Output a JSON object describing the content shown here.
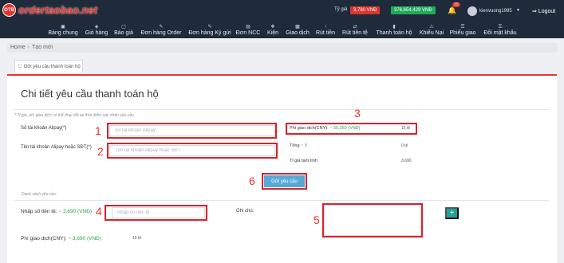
{
  "header": {
    "logo_badge": "OTB",
    "logo_text": "ordertaobao.net",
    "rate_label": "Tỷ giá",
    "rate_value": "3,780 VNĐ",
    "balance": "376,654,429 VNĐ",
    "notification_count": "10",
    "username": "kienvuong1995",
    "logout": "Logout"
  },
  "nav": {
    "items": [
      {
        "label": "Bảng chung",
        "icon": "dashboard-icon"
      },
      {
        "label": "Giỏ hàng",
        "icon": "cart-icon"
      },
      {
        "label": "Báo giá",
        "icon": "quote-icon"
      },
      {
        "label": "Đơn hàng Order",
        "icon": "order-icon"
      },
      {
        "label": "Đơn hàng Ký gửi",
        "icon": "consign-icon"
      },
      {
        "label": "Đơn NCC",
        "icon": "supplier-icon"
      },
      {
        "label": "Kiện",
        "icon": "package-icon"
      },
      {
        "label": "Giao dịch",
        "icon": "transaction-icon"
      },
      {
        "label": "Rút tiền",
        "icon": "withdraw-icon"
      },
      {
        "label": "Rút tiền tệ",
        "icon": "currency-withdraw-icon"
      },
      {
        "label": "Thanh toán hộ",
        "icon": "payment-icon"
      },
      {
        "label": "Khiếu Nại",
        "icon": "complaint-icon"
      },
      {
        "label": "Phiếu giao",
        "icon": "delivery-note-icon"
      },
      {
        "label": "Đổi mật khẩu",
        "icon": "key-icon"
      }
    ]
  },
  "breadcrumb": {
    "home": "Home",
    "current": "Tạo mới"
  },
  "tab": {
    "label": "Gửi yêu cầu thanh toán hộ"
  },
  "form": {
    "title": "Chi tiết yêu cầu thanh toán hộ",
    "note": "* Tỉ giá, phí giao dịch có thể thay đổi tại thời điểm xác nhận yêu cầu",
    "alipay_label": "Số tài khoản Alipay(*)",
    "alipay_placeholder": "Số tài khoản Alipay",
    "name_label": "Tên tài khoản Alipay hoặc SĐT(*)",
    "name_placeholder": "Tên tài khoản Alipay hoặc SĐT",
    "fee_label": "Phí giao dịch(CNY):",
    "fee_vnd": "~ 55,350 (VNĐ)",
    "fee_value": "15 tệ",
    "total_label": "Tổng",
    "total_vnd": "~ 0",
    "total_value": "0 tệ",
    "rate_label": "Tỉ giá tạm tính",
    "rate_value": "3,690",
    "submit": "Gửi yêu cầu",
    "list_title": "Danh sách yêu cầu:",
    "amount_label": "Nhập số tiền tệ:",
    "amount_vnd": "~ 3,690 (VNĐ)",
    "amount_placeholder": "Nhập số tiền tệ",
    "note_label": "Ghi chú:",
    "row_fee_label": "Phí giao dịch(CNY):",
    "row_fee_vnd": "~ 3,690 (VNĐ)",
    "row_fee_value": "15 tệ",
    "add": "+"
  },
  "annotations": [
    "1",
    "2",
    "3",
    "4",
    "5",
    "6"
  ],
  "colors": {
    "accent": "#e8322c",
    "header_bg": "#1f2b3a",
    "balance": "#1faa59",
    "submit": "#5aa8d8",
    "add": "#1ba39c"
  }
}
